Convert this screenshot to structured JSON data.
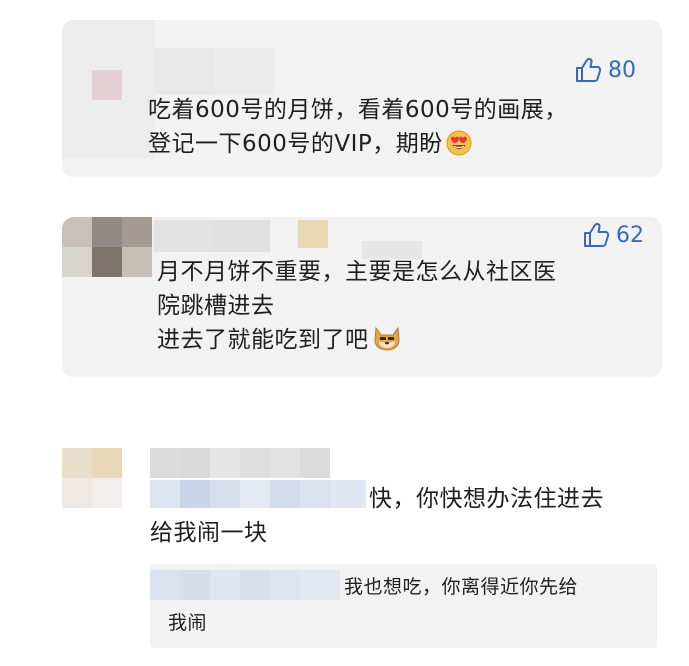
{
  "comments": [
    {
      "likes": "80",
      "lines": [
        "吃着600号的月饼，看着600号的画展，",
        "登记一下600号的VIP，期盼"
      ],
      "emoji": "heart-eyes-emoji"
    },
    {
      "likes": "62",
      "lines": [
        "月不月饼不重要，主要是怎么从社区医",
        "院跳槽进去",
        "进去了就能吃到了吧"
      ],
      "emoji": "doge-emoji"
    },
    {
      "lines": [
        "快，你快想办法住进去",
        "给我闹一块"
      ]
    }
  ],
  "reply": {
    "lines": [
      "我也想吃，你离得近你先给",
      "我闹"
    ]
  },
  "icons": {
    "like": "thumbs-up-icon"
  },
  "colors": {
    "like_accent": "#3b69b8",
    "card_bg": "#f2f2f2"
  }
}
